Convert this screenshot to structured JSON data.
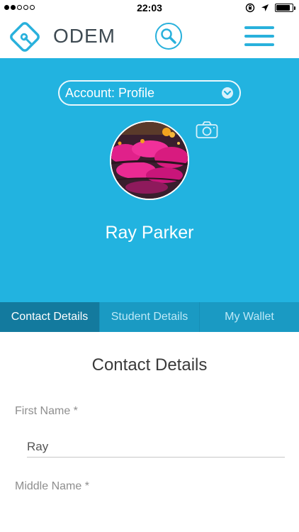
{
  "status_bar": {
    "time": "22:03",
    "signal_bars_filled": 2,
    "signal_bars_total": 5,
    "battery_level": 0.85
  },
  "header": {
    "brand": "ODEM",
    "logo_icon": "odem-logo-icon",
    "search_icon": "search-icon",
    "menu_icon": "hamburger-menu-icon"
  },
  "profile": {
    "account_select": "Account: Profile",
    "name": "Ray Parker",
    "camera_icon": "camera-icon"
  },
  "tabs": [
    {
      "label": "Contact Details",
      "active": true
    },
    {
      "label": "Student Details",
      "active": false
    },
    {
      "label": "My Wallet",
      "active": false
    }
  ],
  "form": {
    "title": "Contact Details",
    "first_name_label": "First Name *",
    "first_name_value": "Ray",
    "middle_name_label": "Middle Name *"
  },
  "colors": {
    "accent": "#22b3e0",
    "tab_bar": "#1a9ac3",
    "tab_active": "#137a9e"
  }
}
